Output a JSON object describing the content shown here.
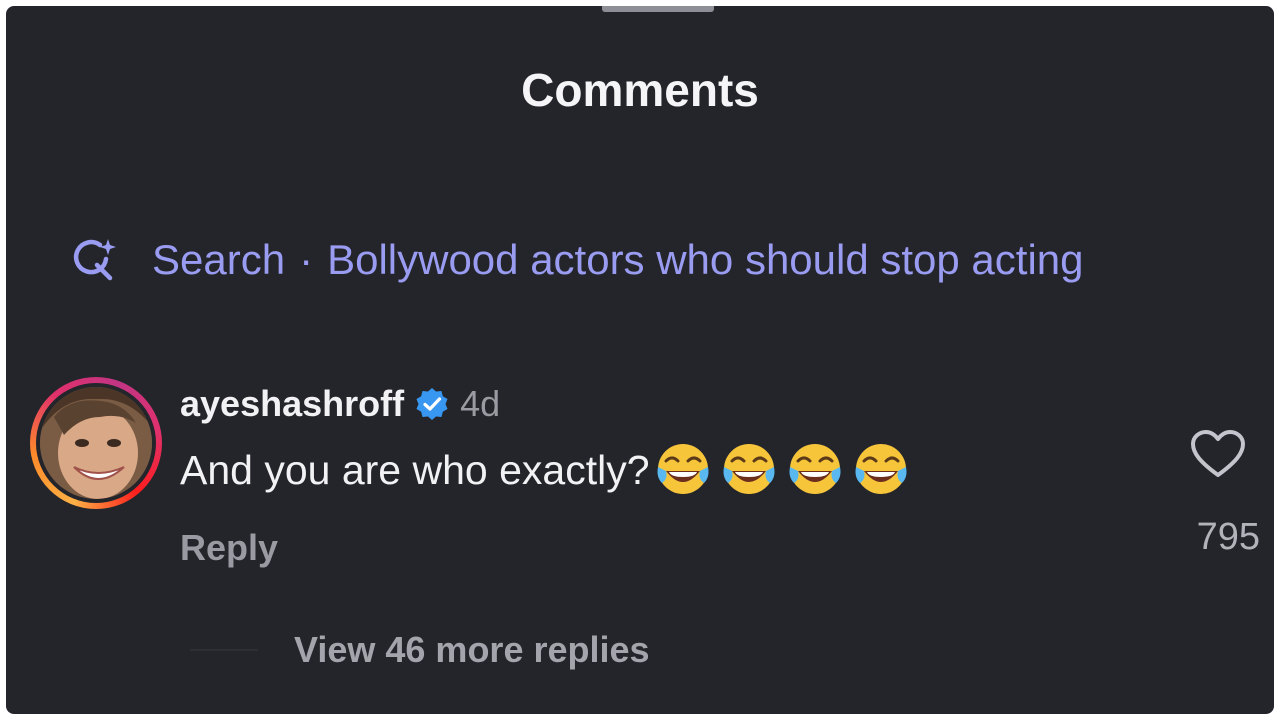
{
  "header": {
    "title": "Comments"
  },
  "search": {
    "label": "Search",
    "separator": "·",
    "query": "Bollywood actors who should stop acting"
  },
  "comment": {
    "username": "ayeshashroff",
    "verified": true,
    "time": "4d",
    "text": "And you are who exactly?",
    "emojis": [
      "😂",
      "😂",
      "😂",
      "😂"
    ],
    "reply_label": "Reply",
    "like_count": "795",
    "view_replies_label": "View 46 more replies"
  },
  "colors": {
    "background": "#24252b",
    "search_accent": "#9a9cf2",
    "verified_blue": "#3897f0",
    "primary_text": "#f2f2f4",
    "secondary_text": "#9a9ba2"
  },
  "icons": {
    "search": "sparkle-search-icon",
    "verified": "verified-badge-icon",
    "like": "heart-outline-icon",
    "emoji": "face-with-tears-of-joy-emoji"
  }
}
